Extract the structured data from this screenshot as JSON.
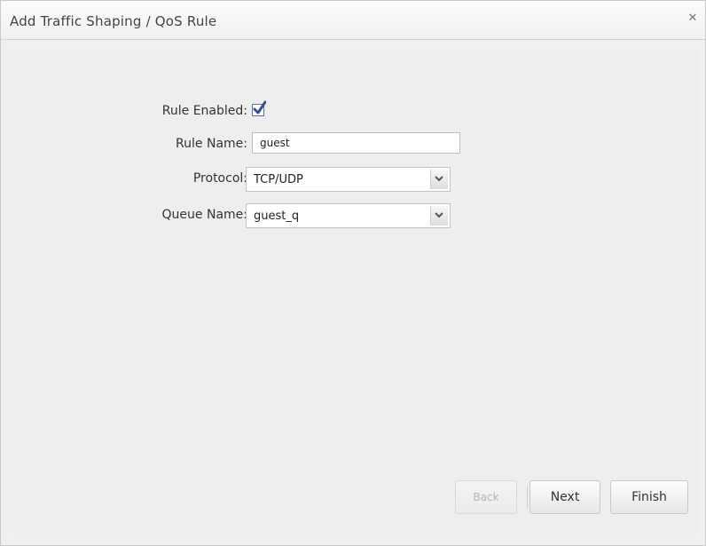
{
  "dialog": {
    "title": "Add Traffic Shaping / QoS Rule",
    "close_glyph": "✕"
  },
  "form": {
    "rule_enabled": {
      "label": "Rule Enabled:",
      "checked": true
    },
    "rule_name": {
      "label": "Rule Name:",
      "value": "guest"
    },
    "protocol": {
      "label": "Protocol:",
      "selected": "TCP/UDP"
    },
    "queue_name": {
      "label": "Queue Name:",
      "selected": "guest_q"
    }
  },
  "buttons": {
    "back": "Back",
    "next": "Next",
    "finish": "Finish"
  },
  "colors": {
    "checkbox_accent": "#3b4f8f"
  }
}
